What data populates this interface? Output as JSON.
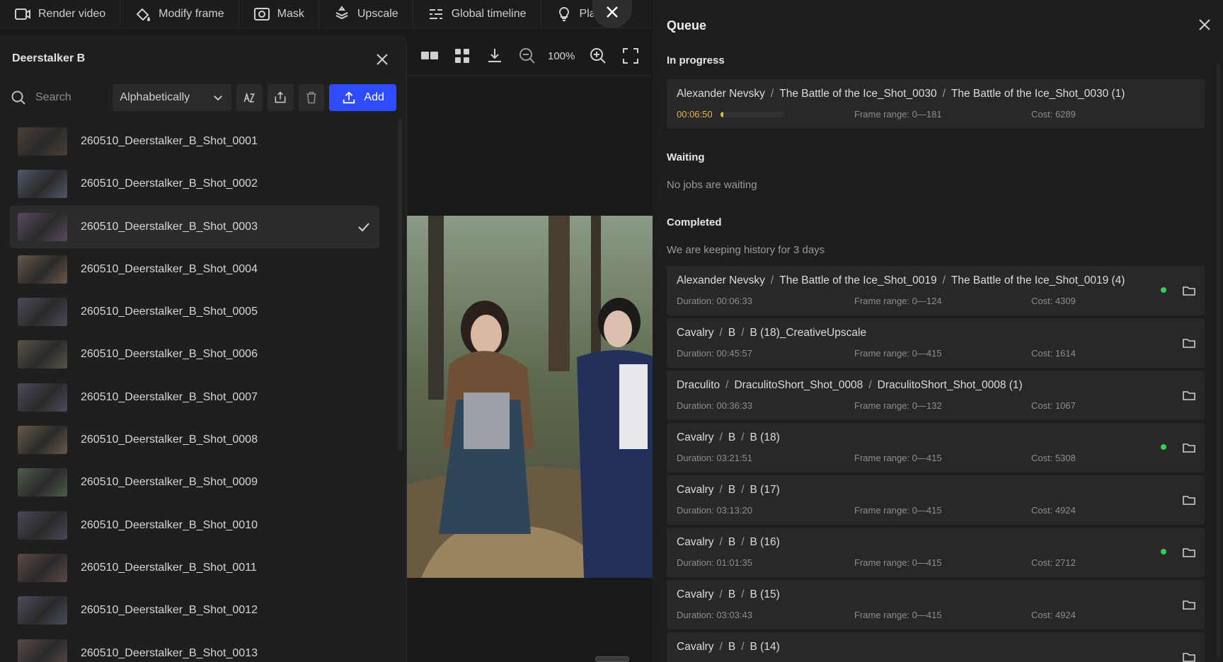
{
  "toolbar": {
    "items": [
      {
        "label": "Render video",
        "icon": "video-icon"
      },
      {
        "label": "Modify frame",
        "icon": "paint-bucket-icon"
      },
      {
        "label": "Mask",
        "icon": "mask-icon"
      },
      {
        "label": "Upscale",
        "icon": "upscale-icon"
      },
      {
        "label": "Global timeline",
        "icon": "timeline-icon"
      },
      {
        "label": "Pla",
        "icon": "lightbulb-icon"
      }
    ]
  },
  "left_panel": {
    "title": "Deerstalker B",
    "search_placeholder": "Search",
    "sort_value": "Alphabetically",
    "add_label": "Add",
    "shots": [
      {
        "name": "260510_Deerstalker_B_Shot_0001",
        "selected": false,
        "thumb_color": "#4a3f38"
      },
      {
        "name": "260510_Deerstalker_B_Shot_0002",
        "selected": false,
        "thumb_color": "#4f5a6b"
      },
      {
        "name": "260510_Deerstalker_B_Shot_0003",
        "selected": true,
        "thumb_color": "#5a4a62"
      },
      {
        "name": "260510_Deerstalker_B_Shot_0004",
        "selected": false,
        "thumb_color": "#6a5848"
      },
      {
        "name": "260510_Deerstalker_B_Shot_0005",
        "selected": false,
        "thumb_color": "#4e4a5c"
      },
      {
        "name": "260510_Deerstalker_B_Shot_0006",
        "selected": false,
        "thumb_color": "#5a5448"
      },
      {
        "name": "260510_Deerstalker_B_Shot_0007",
        "selected": false,
        "thumb_color": "#4f4a5e"
      },
      {
        "name": "260510_Deerstalker_B_Shot_0008",
        "selected": false,
        "thumb_color": "#6a5a4a"
      },
      {
        "name": "260510_Deerstalker_B_Shot_0009",
        "selected": false,
        "thumb_color": "#4f5e4a"
      },
      {
        "name": "260510_Deerstalker_B_Shot_0010",
        "selected": false,
        "thumb_color": "#48485a"
      },
      {
        "name": "260510_Deerstalker_B_Shot_0011",
        "selected": false,
        "thumb_color": "#5e4a44"
      },
      {
        "name": "260510_Deerstalker_B_Shot_0012",
        "selected": false,
        "thumb_color": "#4a4c5e"
      },
      {
        "name": "260510_Deerstalker_B_Shot_0013",
        "selected": false,
        "thumb_color": "#5a4848"
      }
    ]
  },
  "viewer": {
    "zoom": "100%"
  },
  "queue": {
    "title": "Queue",
    "in_progress_label": "In progress",
    "in_progress": {
      "path": [
        "Alexander Nevsky",
        "The Battle of the Ice_Shot_0030",
        "The Battle of the Ice_Shot_0030 (1)"
      ],
      "elapsed": "00:06:50",
      "progress": 0.04,
      "frame_range": "Frame range: 0—181",
      "cost": "Cost: 6289"
    },
    "waiting_label": "Waiting",
    "waiting_note": "No jobs are waiting",
    "completed_label": "Completed",
    "completed_note": "We are keeping history for 3 days",
    "completed": [
      {
        "path": [
          "Alexander Nevsky",
          "The Battle of the Ice_Shot_0019",
          "The Battle of the Ice_Shot_0019 (4)"
        ],
        "duration": "Duration: 00:06:33",
        "frame_range": "Frame range: 0—124",
        "cost": "Cost: 4309",
        "dot": true
      },
      {
        "path": [
          "Cavalry",
          "B",
          "B (18)_CreativeUpscale"
        ],
        "duration": "Duration: 00:45:57",
        "frame_range": "Frame range: 0—415",
        "cost": "Cost: 1614",
        "dot": false
      },
      {
        "path": [
          "Draculito",
          "DraculitoShort_Shot_0008",
          "DraculitoShort_Shot_0008 (1)"
        ],
        "duration": "Duration: 00:36:33",
        "frame_range": "Frame range: 0—132",
        "cost": "Cost: 1067",
        "dot": false
      },
      {
        "path": [
          "Cavalry",
          "B",
          "B (18)"
        ],
        "duration": "Duration: 03:21:51",
        "frame_range": "Frame range: 0—415",
        "cost": "Cost: 5308",
        "dot": true
      },
      {
        "path": [
          "Cavalry",
          "B",
          "B (17)"
        ],
        "duration": "Duration: 03:13:20",
        "frame_range": "Frame range: 0—415",
        "cost": "Cost: 4924",
        "dot": false
      },
      {
        "path": [
          "Cavalry",
          "B",
          "B (16)"
        ],
        "duration": "Duration: 01:01:35",
        "frame_range": "Frame range: 0—415",
        "cost": "Cost: 2712",
        "dot": true
      },
      {
        "path": [
          "Cavalry",
          "B",
          "B (15)"
        ],
        "duration": "Duration: 03:03:43",
        "frame_range": "Frame range: 0—415",
        "cost": "Cost: 4924",
        "dot": false
      },
      {
        "path": [
          "Cavalry",
          "B",
          "B (14)"
        ],
        "duration": "",
        "frame_range": "",
        "cost": "",
        "dot": false
      }
    ]
  },
  "colors": {
    "accent": "#2e4bff",
    "progress": "#e5b84c",
    "status_ok": "#32d25a"
  }
}
